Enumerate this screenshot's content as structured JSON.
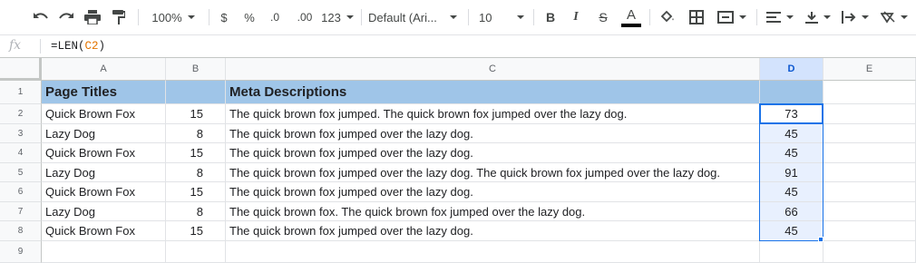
{
  "toolbar": {
    "zoom": "100%",
    "currency": "$",
    "percent": "%",
    "decrease_decimal": ".0",
    "increase_decimal": ".00",
    "more_formats": "123",
    "font": "Default (Ari...",
    "font_size": "10",
    "bold": "B",
    "italic": "I",
    "strikethrough": "S",
    "text_color": "A"
  },
  "formula_bar": {
    "fx": "fx",
    "formula_prefix": "=LEN(",
    "formula_ref": "C2",
    "formula_suffix": ")"
  },
  "columns": [
    "A",
    "B",
    "C",
    "D",
    "E"
  ],
  "rows": [
    "1",
    "2",
    "3",
    "4",
    "5",
    "6",
    "7",
    "8",
    "9"
  ],
  "header_row": {
    "a": "Page Titles",
    "b": "",
    "c": "Meta Descriptions",
    "d": ""
  },
  "data_rows": [
    {
      "a": "Quick Brown Fox",
      "b": "15",
      "c": "The quick brown fox jumped. The quick brown fox jumped over the lazy dog.",
      "d": "73"
    },
    {
      "a": "Lazy Dog",
      "b": "8",
      "c": "The quick brown fox jumped over the lazy dog.",
      "d": "45"
    },
    {
      "a": "Quick Brown Fox",
      "b": "15",
      "c": "The quick brown fox jumped over the lazy dog.",
      "d": "45"
    },
    {
      "a": "Lazy Dog",
      "b": "8",
      "c": "The quick brown fox jumped over the lazy dog. The quick brown fox jumped over the lazy dog.",
      "d": "91"
    },
    {
      "a": "Quick Brown Fox",
      "b": "15",
      "c": "The quick brown fox jumped over the lazy dog.",
      "d": "45"
    },
    {
      "a": "Lazy Dog",
      "b": "8",
      "c": "The quick brown fox. The quick brown fox jumped over the lazy dog.",
      "d": "66"
    },
    {
      "a": "Quick Brown Fox",
      "b": "15",
      "c": "The quick brown fox jumped over the lazy dog.",
      "d": "45"
    }
  ],
  "colors": {
    "header_fill": "#9fc5e8",
    "selection": "#1a73e8",
    "selection_fill": "#e8f0fe",
    "formula_ref": "#e37400"
  },
  "icons": [
    "undo-icon",
    "redo-icon",
    "print-icon",
    "paint-format-icon",
    "fill-color-icon",
    "borders-icon",
    "merge-cells-icon",
    "align-left-icon",
    "valign-bottom-icon",
    "text-wrap-icon",
    "text-rotation-icon"
  ]
}
